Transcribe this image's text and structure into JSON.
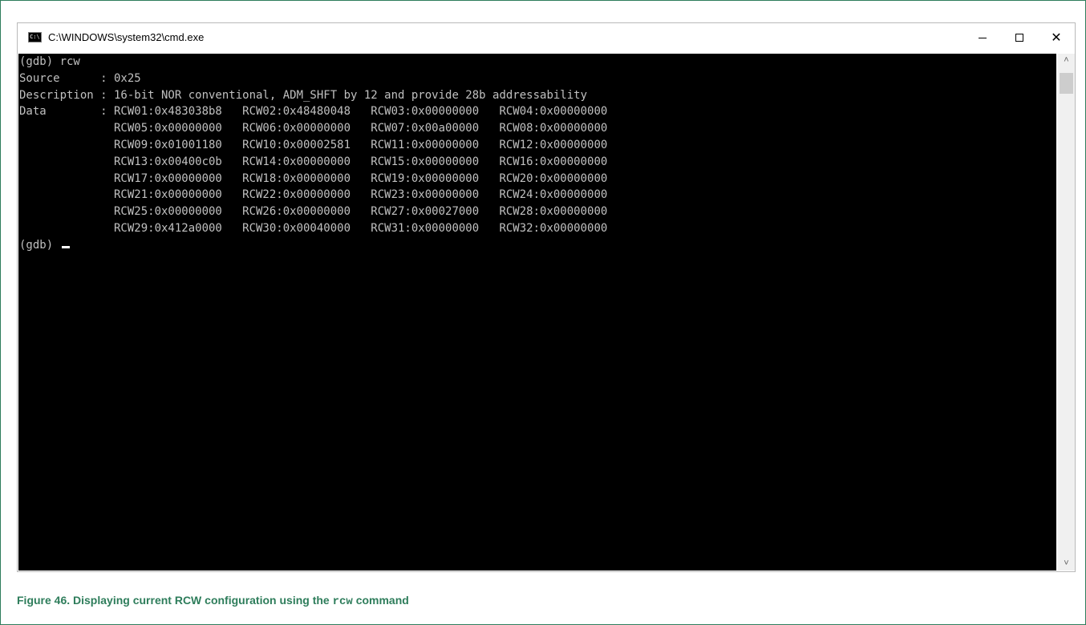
{
  "window": {
    "title": "C:\\WINDOWS\\system32\\cmd.exe",
    "app_icon_glyph": "C:\\",
    "minimize_icon": "minimize-icon",
    "maximize_icon": "maximize-icon",
    "close_icon": "close-icon",
    "close_glyph": "✕"
  },
  "console": {
    "lines": [
      "(gdb) rcw",
      "Source      : 0x25",
      "Description : 16-bit NOR conventional, ADM_SHFT by 12 and provide 28b addressability",
      "Data        : RCW01:0x483038b8   RCW02:0x48480048   RCW03:0x00000000   RCW04:0x00000000",
      "              RCW05:0x00000000   RCW06:0x00000000   RCW07:0x00a00000   RCW08:0x00000000",
      "              RCW09:0x01001180   RCW10:0x00002581   RCW11:0x00000000   RCW12:0x00000000",
      "              RCW13:0x00400c0b   RCW14:0x00000000   RCW15:0x00000000   RCW16:0x00000000",
      "              RCW17:0x00000000   RCW18:0x00000000   RCW19:0x00000000   RCW20:0x00000000",
      "              RCW21:0x00000000   RCW22:0x00000000   RCW23:0x00000000   RCW24:0x00000000",
      "              RCW25:0x00000000   RCW26:0x00000000   RCW27:0x00027000   RCW28:0x00000000",
      "              RCW29:0x412a0000   RCW30:0x00040000   RCW31:0x00000000   RCW32:0x00000000"
    ],
    "prompt": "(gdb) "
  },
  "scrollbar": {
    "up_glyph": "˄",
    "down_glyph": "˅"
  },
  "caption": {
    "prefix": "Figure 46. Displaying current RCW configuration using the ",
    "command": "rcw",
    "suffix": " command"
  },
  "colors": {
    "console_bg": "#000000",
    "console_text": "#c0c0c0",
    "caption": "#2e7d5b",
    "frame_border": "#2e7d5b"
  }
}
